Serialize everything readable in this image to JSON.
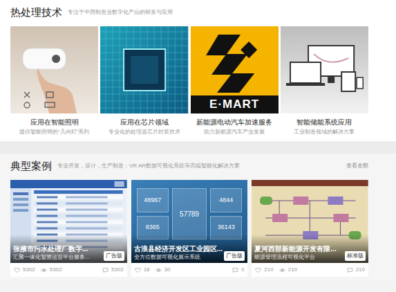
{
  "tech": {
    "title": "热处理技术",
    "subtitle": "专注于中国制造业数字化产品的研发与应用",
    "items": [
      {
        "kind": "lamp",
        "title": "应用在智能照明",
        "desc": "提供智能照明的“几何灯”系列"
      },
      {
        "kind": "chip",
        "title": "应用在芯片领域",
        "desc": "专业化的处理器芯片封装技术"
      },
      {
        "kind": "logo",
        "logo": "E·MART",
        "title": "新能源电动汽车加速服务",
        "desc": "助力新能源汽车产业发展"
      },
      {
        "kind": "devices",
        "title": "智能储能系统应用",
        "desc": "工业制造领域的解决方案"
      }
    ]
  },
  "cases": {
    "title": "典型案例",
    "subtitle": "专业开发，设计，生产制造：VR AR数据可视化系统等高端智能化解决方案",
    "more": "查看全部",
    "items": [
      {
        "kind": "table",
        "title": "张掖市污水处理厂数字...",
        "desc": "汇聚一体化智慧运营平台服务...",
        "badge": "广告版",
        "stats": [
          "5302",
          "5302",
          "5302"
        ]
      },
      {
        "kind": "dashboard",
        "numbers": [
          "48967",
          "4844",
          "57789",
          "8365",
          "36143"
        ],
        "title": "古浪县经济开发区工业园区...",
        "desc": "全方位数据可视化展示系统",
        "badge": "广告版",
        "stats": [
          "18",
          "30",
          "0"
        ]
      },
      {
        "kind": "flow",
        "title": "夏河西部新能源开发有限...",
        "desc": "能源管理流程可视化平台",
        "badge": "标准版",
        "stats": [
          "210",
          "210",
          "210"
        ]
      }
    ]
  }
}
